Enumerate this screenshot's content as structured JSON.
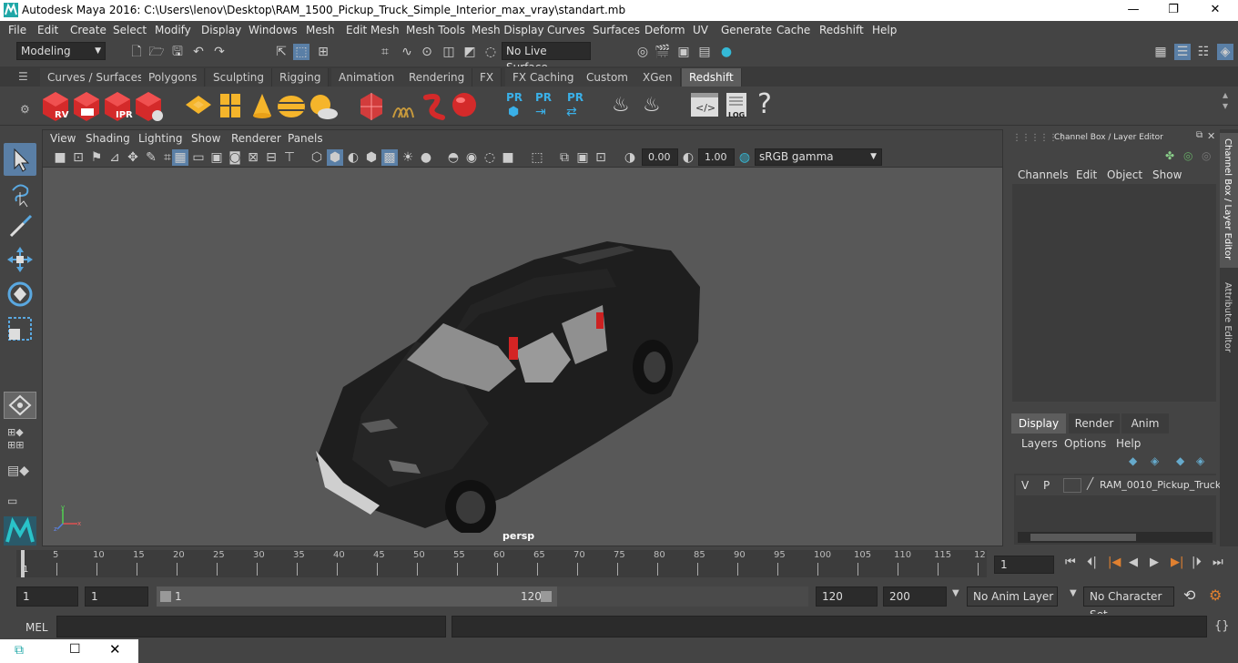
{
  "window": {
    "title": "Autodesk Maya 2016: C:\\Users\\lenov\\Desktop\\RAM_1500_Pickup_Truck_Simple_Interior_max_vray\\standart.mb",
    "minimize": "—",
    "maximize": "❐",
    "close": "✕"
  },
  "menu": [
    "File",
    "Edit",
    "Create",
    "Select",
    "Modify",
    "Display",
    "Windows",
    "Mesh",
    "Edit Mesh",
    "Mesh Tools",
    "Mesh Display",
    "Curves",
    "Surfaces",
    "Deform",
    "UV",
    "Generate",
    "Cache",
    "Redshift",
    "Help"
  ],
  "status": {
    "mode": "Modeling",
    "live_surface": "No Live Surface"
  },
  "shelf_tabs": [
    "Curves / Surfaces",
    "Polygons",
    "Sculpting",
    "Rigging",
    "Animation",
    "Rendering",
    "FX",
    "FX Caching",
    "Custom",
    "XGen",
    "Redshift"
  ],
  "shelf_icons": {
    "rv": "RV",
    "ipr": "IPR",
    "pr": "PR",
    "log": "LOG",
    "help": "?"
  },
  "viewport": {
    "menu": [
      "View",
      "Shading",
      "Lighting",
      "Show",
      "Renderer",
      "Panels"
    ],
    "exposure": "0.00",
    "gamma": "1.00",
    "colorspace": "sRGB gamma",
    "camera": "persp"
  },
  "channelbox": {
    "title": "Channel Box / Layer Editor",
    "menu": [
      "Channels",
      "Edit",
      "Object",
      "Show"
    ],
    "tabs": [
      "Display",
      "Render",
      "Anim"
    ],
    "layer_menu": [
      "Layers",
      "Options",
      "Help"
    ],
    "layer": {
      "v": "V",
      "p": "P",
      "name": "RAM_0010_Pickup_Truck"
    }
  },
  "side_tabs": [
    "Channel Box / Layer Editor",
    "Attribute Editor"
  ],
  "timeline": {
    "ticks": [
      "5",
      "10",
      "15",
      "20",
      "25",
      "30",
      "35",
      "40",
      "45",
      "50",
      "55",
      "60",
      "65",
      "70",
      "75",
      "80",
      "85",
      "90",
      "95",
      "100",
      "105",
      "110",
      "115",
      "12"
    ],
    "start": "1",
    "current": "1"
  },
  "range": {
    "start": "1",
    "current": "1",
    "slider_start": "1",
    "slider_end": "120",
    "end": "120",
    "max": "200",
    "anim_layer": "No Anim Layer",
    "char_set": "No Character Set"
  },
  "cmd": {
    "label": "MEL"
  }
}
